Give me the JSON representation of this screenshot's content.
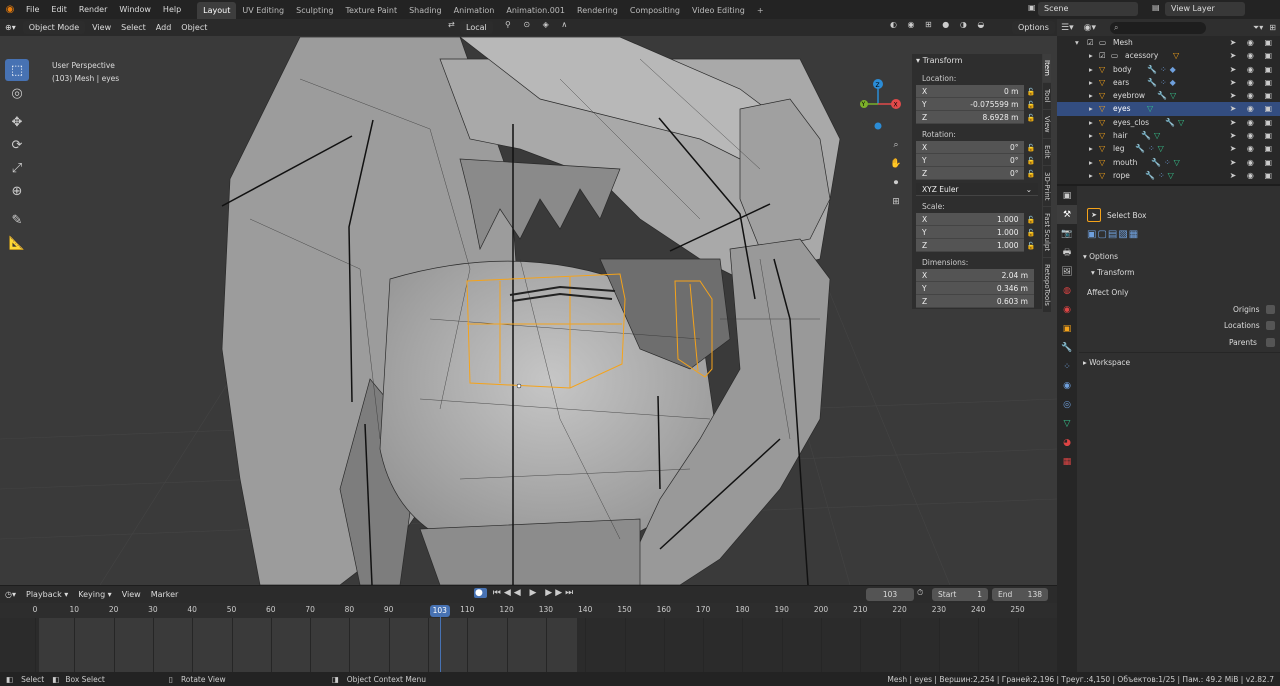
{
  "topbar": {
    "menus": [
      "File",
      "Edit",
      "Render",
      "Window",
      "Help"
    ],
    "workspaces": [
      "Layout",
      "UV Editing",
      "Sculpting",
      "Texture Paint",
      "Shading",
      "Animation",
      "Animation.001",
      "Rendering",
      "Compositing",
      "Video Editing"
    ],
    "active_workspace": "Layout",
    "add_tab": "+",
    "scene": "Scene",
    "view_layer": "View Layer"
  },
  "viewport": {
    "mode": "Object Mode",
    "menus": [
      "View",
      "Select",
      "Add",
      "Object"
    ],
    "orientation": "Local",
    "options": "Options",
    "info_line1": "User Perspective",
    "info_line2": "(103) Mesh | eyes",
    "gizmo": {
      "x": "X",
      "y": "Y",
      "z": "Z"
    }
  },
  "npanel": {
    "title": "Transform",
    "location_label": "Location:",
    "location": [
      {
        "axis": "X",
        "value": "0 m"
      },
      {
        "axis": "Y",
        "value": "-0.075599 m"
      },
      {
        "axis": "Z",
        "value": "8.6928 m"
      }
    ],
    "rotation_label": "Rotation:",
    "rotation": [
      {
        "axis": "X",
        "value": "0°"
      },
      {
        "axis": "Y",
        "value": "0°"
      },
      {
        "axis": "Z",
        "value": "0°"
      }
    ],
    "rotation_mode": "XYZ Euler",
    "scale_label": "Scale:",
    "scale": [
      {
        "axis": "X",
        "value": "1.000"
      },
      {
        "axis": "Y",
        "value": "1.000"
      },
      {
        "axis": "Z",
        "value": "1.000"
      }
    ],
    "dimensions_label": "Dimensions:",
    "dimensions": [
      {
        "axis": "X",
        "value": "2.04 m"
      },
      {
        "axis": "Y",
        "value": "0.346 m"
      },
      {
        "axis": "Z",
        "value": "0.603 m"
      }
    ],
    "tabs": [
      "Item",
      "Tool",
      "View",
      "Edit",
      "3D-Print",
      "Fast Sculpt",
      "RetopoTools"
    ]
  },
  "outliner": {
    "root": "Mesh",
    "items": [
      {
        "name": "acessory",
        "selected": false
      },
      {
        "name": "body",
        "selected": false
      },
      {
        "name": "ears",
        "selected": false
      },
      {
        "name": "eyebrow",
        "selected": false
      },
      {
        "name": "eyes",
        "selected": true
      },
      {
        "name": "eyes_clos",
        "selected": false
      },
      {
        "name": "hair",
        "selected": false
      },
      {
        "name": "leg",
        "selected": false
      },
      {
        "name": "mouth",
        "selected": false
      },
      {
        "name": "rope",
        "selected": false
      }
    ]
  },
  "properties": {
    "tool_name": "Select Box",
    "options": "Options",
    "transform": "Transform",
    "affect_only": "Affect Only",
    "origins": "Origins",
    "locations": "Locations",
    "parents": "Parents",
    "workspace": "Workspace"
  },
  "timeline": {
    "menus": [
      "Playback",
      "Keying",
      "View",
      "Marker"
    ],
    "current_frame": "103",
    "start_label": "Start",
    "start": "1",
    "end_label": "End",
    "end": "138",
    "ticks": [
      0,
      10,
      20,
      30,
      40,
      50,
      60,
      70,
      80,
      90,
      100,
      110,
      120,
      130,
      140,
      150,
      160,
      170,
      180,
      190,
      200,
      210,
      220,
      230,
      240,
      250
    ],
    "range_start": 1,
    "range_end": 138,
    "playhead": 103
  },
  "status": {
    "select": "Select",
    "box_select": "Box Select",
    "rotate_view": "Rotate View",
    "context_menu": "Object Context Menu",
    "stats": "Mesh | eyes | Вершин:2,254 | Граней:2,196 | Треуг.:4,150 | Объектов:1/25 | Пам.: 49.2 MiB | v2.82.7"
  },
  "colors": {
    "accent": "#4772b3",
    "selection": "#f5a31a",
    "background": "#3a3a3a"
  }
}
